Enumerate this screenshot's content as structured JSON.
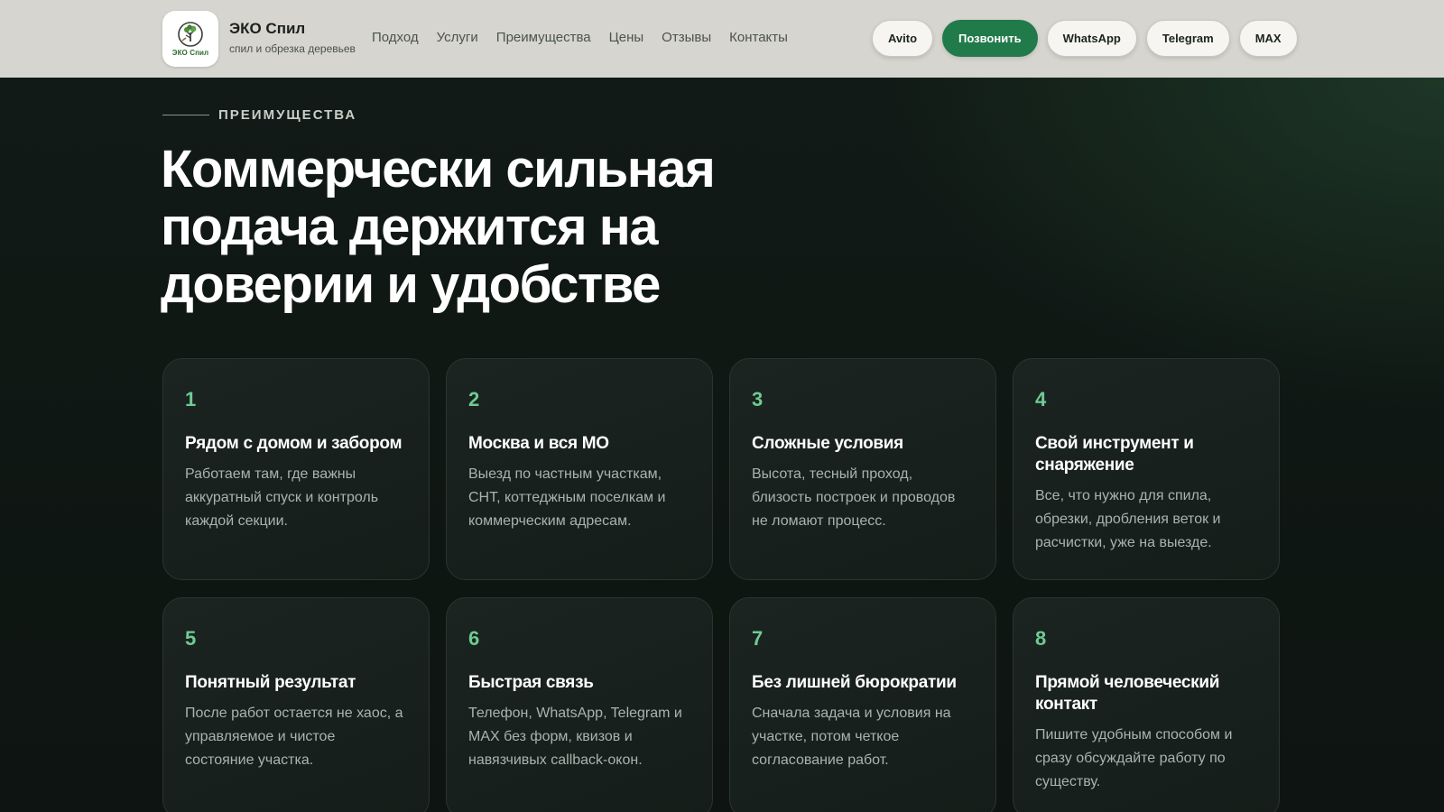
{
  "header": {
    "brand_name": "ЭКО Спил",
    "brand_sub": "спил и обрезка деревьев",
    "logo_text": "ЭКО Спил",
    "nav": [
      "Подход",
      "Услуги",
      "Преимущества",
      "Цены",
      "Отзывы",
      "Контакты"
    ],
    "buttons": {
      "avito": "Avito",
      "call": "Позвонить",
      "whatsapp": "WhatsApp",
      "telegram": "Telegram",
      "max": "MAX"
    }
  },
  "section": {
    "eyebrow": "ПРЕИМУЩЕСТВА",
    "title": "Коммерчески сильная подача держится на доверии и удобстве"
  },
  "cards": [
    {
      "num": "1",
      "title": "Рядом с домом и забором",
      "text": "Работаем там, где важны аккуратный спуск и контроль каждой секции."
    },
    {
      "num": "2",
      "title": "Москва и вся МО",
      "text": "Выезд по частным участкам, СНТ, коттеджным поселкам и коммерческим адресам."
    },
    {
      "num": "3",
      "title": "Сложные условия",
      "text": "Высота, тесный проход, близость построек и проводов не ломают процесс."
    },
    {
      "num": "4",
      "title": "Свой инструмент и снаряжение",
      "text": "Все, что нужно для спила, обрезки, дробления веток и расчистки, уже на выезде."
    },
    {
      "num": "5",
      "title": "Понятный результат",
      "text": "После работ остается не хаос, а управляемое и чистое состояние участка."
    },
    {
      "num": "6",
      "title": "Быстрая связь",
      "text": "Телефон, WhatsApp, Telegram и MAX без форм, квизов и навязчивых callback-окон."
    },
    {
      "num": "7",
      "title": "Без лишней бюрократии",
      "text": "Сначала задача и условия на участке, потом четкое согласование работ."
    },
    {
      "num": "8",
      "title": "Прямой человеческий контакт",
      "text": "Пишите удобным способом и сразу обсуждайте работу по существу."
    }
  ],
  "colors": {
    "header_bg": "#d6d5cf",
    "accent_green": "#217a4a",
    "card_number": "#6fcb93",
    "page_bg": "#0e1512"
  }
}
